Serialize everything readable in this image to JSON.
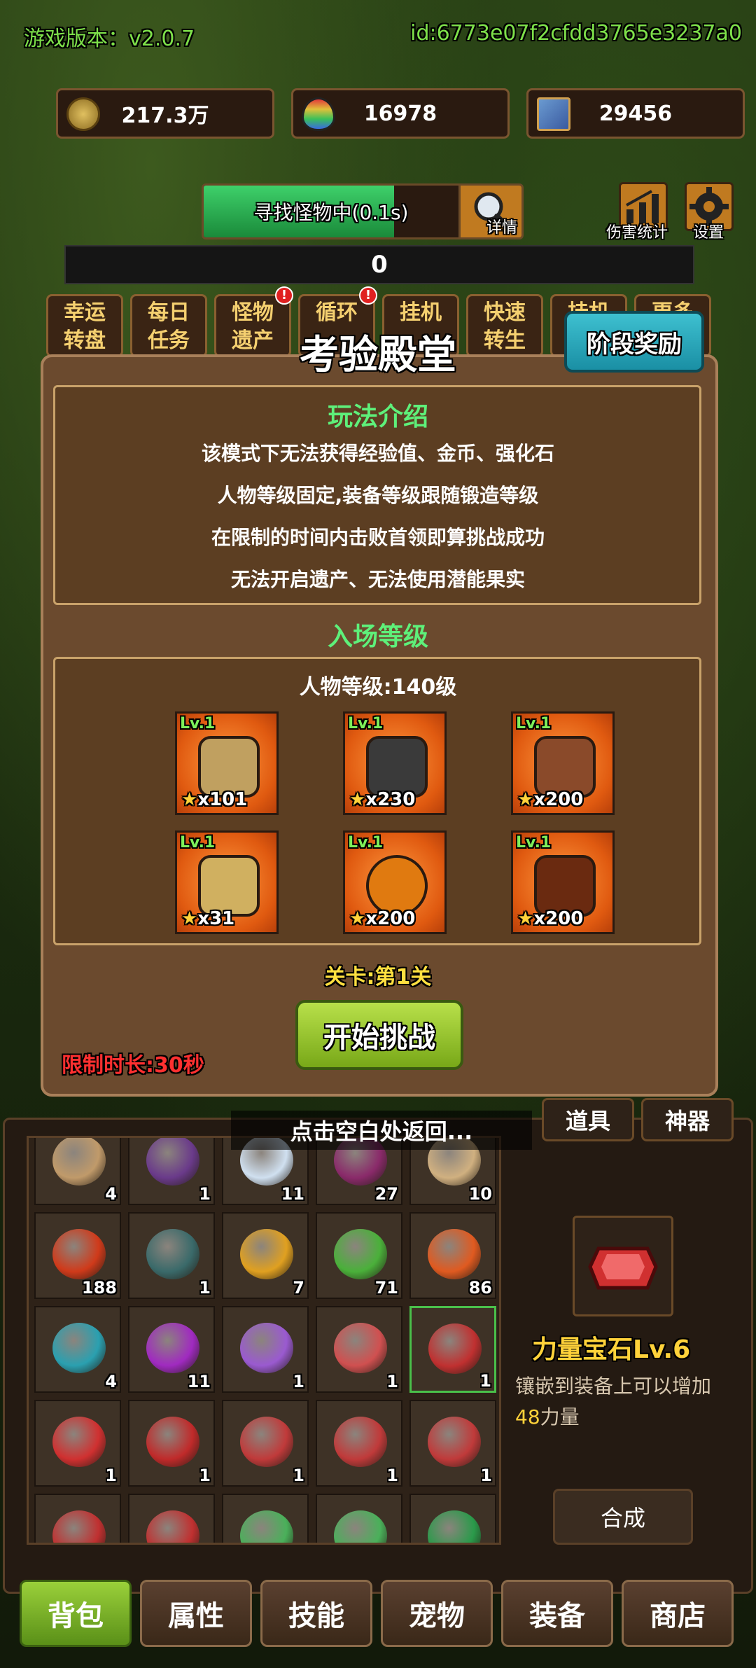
{
  "header": {
    "version": "游戏版本：v2.0.7",
    "id": "id:6773e07f2cfdd3765e3237a0"
  },
  "resources": [
    {
      "icon": "gold-coin-icon",
      "value": "217.3万",
      "color": "#8a6a20"
    },
    {
      "icon": "rainbow-egg-icon",
      "value": "16978",
      "color": "#c04aa0"
    },
    {
      "icon": "card-icon",
      "value": "29456",
      "color": "#3a6ac0"
    }
  ],
  "search": {
    "label": "寻找怪物中(0.1s)",
    "detail": "详情",
    "progress_pct": 60
  },
  "top_icons": {
    "damage": "伤害统计",
    "settings": "设置"
  },
  "counter": "0",
  "features": [
    {
      "label": "幸运\n转盘",
      "badge": ""
    },
    {
      "label": "每日\n任务",
      "badge": ""
    },
    {
      "label": "怪物\n遗产",
      "badge": "!"
    },
    {
      "label": "循环",
      "badge": "!"
    },
    {
      "label": "挂机",
      "badge": ""
    },
    {
      "label": "快速\n转生",
      "badge": ""
    },
    {
      "label": "挂机",
      "badge": ""
    },
    {
      "label": "更多",
      "badge": ""
    }
  ],
  "modal": {
    "title": "考验殿堂",
    "stage_reward_btn": "阶段奖励",
    "intro_title": "玩法介绍",
    "rules": [
      "该模式下无法获得经验值、金币、强化石",
      "人物等级固定,装备等级跟随锻造等级",
      "在限制的时间内击败首领即算挑战成功",
      "无法开启遗产、无法使用潜能果实"
    ],
    "entry_title": "入场等级",
    "char_level": "人物等级:140级",
    "equipment": [
      {
        "lv": "Lv.1",
        "count": "x101",
        "icon": "sword-icon",
        "color": "#c0a060"
      },
      {
        "lv": "Lv.1",
        "count": "x230",
        "icon": "helmet-icon",
        "color": "#3a3a3a"
      },
      {
        "lv": "Lv.1",
        "count": "x200",
        "icon": "armor-icon",
        "color": "#8a4a2a"
      },
      {
        "lv": "Lv.1",
        "count": "x31",
        "icon": "boots-icon",
        "color": "#d0b060"
      },
      {
        "lv": "Lv.1",
        "count": "x200",
        "icon": "ring-icon",
        "color": "#e07a10"
      },
      {
        "lv": "Lv.1",
        "count": "x200",
        "icon": "necklace-icon",
        "color": "#6a2a10"
      }
    ],
    "stage": "关卡:第1关",
    "start_btn": "开始挑战",
    "time_limit": "限制时长:30秒"
  },
  "close_hint": "点击空白处返回...",
  "inventory": {
    "tabs": [
      "道具",
      "神器"
    ],
    "cells": [
      {
        "n": "4",
        "c": "#c09a6a"
      },
      {
        "n": "1",
        "c": "#6a3a8a"
      },
      {
        "n": "11",
        "c": "#d0e0f0"
      },
      {
        "n": "27",
        "c": "#8a2a6a"
      },
      {
        "n": "10",
        "c": "#d0b080"
      },
      {
        "n": "188",
        "c": "#d03a1a"
      },
      {
        "n": "1",
        "c": "#3a6a6a"
      },
      {
        "n": "7",
        "c": "#e0a020"
      },
      {
        "n": "71",
        "c": "#4ab03a"
      },
      {
        "n": "86",
        "c": "#e05a20"
      },
      {
        "n": "4",
        "c": "#2aa0b0"
      },
      {
        "n": "11",
        "c": "#a02ac0"
      },
      {
        "n": "1",
        "c": "#9a5ad0"
      },
      {
        "n": "1",
        "c": "#d05050"
      },
      {
        "n": "1",
        "c": "#c03030"
      },
      {
        "n": "1",
        "c": "#d03030"
      },
      {
        "n": "1",
        "c": "#c02a2a"
      },
      {
        "n": "1",
        "c": "#c03a3a"
      },
      {
        "n": "1",
        "c": "#c03a3a"
      },
      {
        "n": "1",
        "c": "#c03a3a"
      },
      {
        "n": "",
        "c": "#c03030"
      },
      {
        "n": "",
        "c": "#c03030"
      },
      {
        "n": "",
        "c": "#4ab05a"
      },
      {
        "n": "",
        "c": "#4ab05a"
      },
      {
        "n": "",
        "c": "#2a9a4a"
      }
    ],
    "selected_index": 14,
    "detail": {
      "name": "力量宝石Lv.6",
      "desc_prefix": "镶嵌到装备上可以增加",
      "amount": "48",
      "desc_suffix": "力量",
      "synth": "合成"
    }
  },
  "nav": [
    "背包",
    "属性",
    "技能",
    "宠物",
    "装备",
    "商店"
  ],
  "nav_active": 0
}
